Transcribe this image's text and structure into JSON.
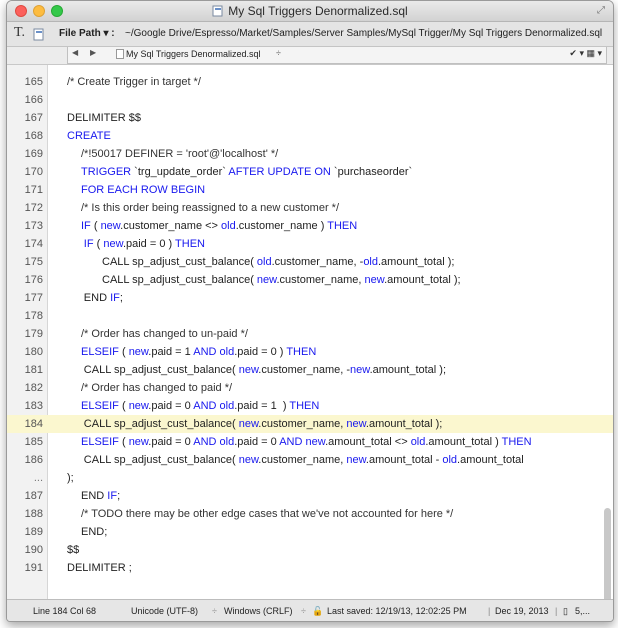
{
  "window": {
    "title": "My Sql Triggers Denormalized.sql"
  },
  "pathbar": {
    "label": "File Path ▾ :",
    "path": "~/Google Drive/Espresso/Market/Samples/Server Samples/MySql Trigger/My Sql Triggers Denormalized.sql"
  },
  "tabbar": {
    "filename": "My Sql Triggers Denormalized.sql",
    "selector": "÷",
    "right_controls": "✔ ▾ ▦ ▾"
  },
  "editor": {
    "highlighted_line": 184,
    "lines": [
      {
        "num": "165",
        "indent": 0,
        "text": "/* Create Trigger in target */"
      },
      {
        "num": "166",
        "indent": 0,
        "text": ""
      },
      {
        "num": "167",
        "indent": 0,
        "text": "DELIMITER $$"
      },
      {
        "num": "168",
        "indent": 0,
        "text": "CREATE"
      },
      {
        "num": "169",
        "indent": 1,
        "text": "/*!50017 DEFINER = 'root'@'localhost' */"
      },
      {
        "num": "170",
        "indent": 1,
        "text": "TRIGGER `trg_update_order` AFTER UPDATE ON `purchaseorder`"
      },
      {
        "num": "171",
        "indent": 1,
        "text": "FOR EACH ROW BEGIN"
      },
      {
        "num": "172",
        "indent": 1,
        "text": "/* Is this order being reassigned to a new customer */"
      },
      {
        "num": "173",
        "indent": 1,
        "text": "IF ( new.customer_name <> old.customer_name ) THEN"
      },
      {
        "num": "174",
        "indent": 1.2,
        "text": "IF ( new.paid = 0 ) THEN"
      },
      {
        "num": "175",
        "indent": 2.5,
        "text": "CALL sp_adjust_cust_balance( old.customer_name, -old.amount_total );"
      },
      {
        "num": "176",
        "indent": 2.5,
        "text": "CALL sp_adjust_cust_balance( new.customer_name, new.amount_total );"
      },
      {
        "num": "177",
        "indent": 1.2,
        "text": "END IF;"
      },
      {
        "num": "178",
        "indent": 0,
        "text": ""
      },
      {
        "num": "179",
        "indent": 1,
        "text": "/* Order has changed to un-paid */"
      },
      {
        "num": "180",
        "indent": 1,
        "text": "ELSEIF ( new.paid = 1 AND old.paid = 0 ) THEN"
      },
      {
        "num": "181",
        "indent": 1.2,
        "text": "CALL sp_adjust_cust_balance( new.customer_name, -new.amount_total );"
      },
      {
        "num": "182",
        "indent": 1,
        "text": "/* Order has changed to paid */"
      },
      {
        "num": "183",
        "indent": 1,
        "text": "ELSEIF ( new.paid = 0 AND old.paid = 1  ) THEN"
      },
      {
        "num": "184",
        "indent": 1.2,
        "text": "CALL sp_adjust_cust_balance( new.customer_name, new.amount_total );"
      },
      {
        "num": "185",
        "indent": 1,
        "text": "ELSEIF ( new.paid = 0 AND old.paid = 0 AND new.amount_total <> old.amount_total ) THEN"
      },
      {
        "num": "186",
        "indent": 1.2,
        "text": "CALL sp_adjust_cust_balance( new.customer_name, new.amount_total - old.amount_total"
      },
      {
        "num": "...",
        "indent": 0,
        "text": ");"
      },
      {
        "num": "187",
        "indent": 1,
        "text": "END IF;"
      },
      {
        "num": "188",
        "indent": 1,
        "text": "/* TODO there may be other edge cases that we've not accounted for here */"
      },
      {
        "num": "189",
        "indent": 1,
        "text": "END;"
      },
      {
        "num": "190",
        "indent": 0,
        "text": "$$"
      },
      {
        "num": "191",
        "indent": 0,
        "text": "DELIMITER ;"
      }
    ]
  },
  "status": {
    "position": "Line 184 Col 68",
    "encoding": "Unicode (UTF-8)",
    "line_endings": "Windows (CRLF)",
    "last_saved": "Last saved: 12/19/13, 12:02:25 PM",
    "date": "Dec 19, 2013",
    "count": "5,..."
  }
}
